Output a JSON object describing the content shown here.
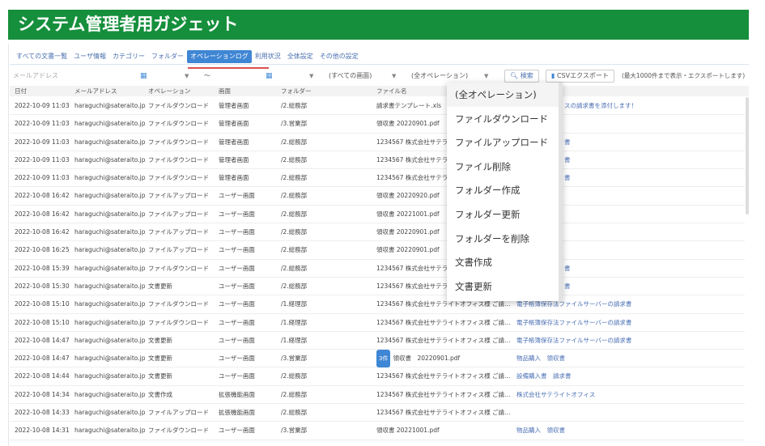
{
  "header": {
    "title": "システム管理者用ガジェット",
    "color": "#168f3c"
  },
  "tabs": [
    {
      "label": "すべての文書一覧"
    },
    {
      "label": "ユーザ情報"
    },
    {
      "label": "カテゴリー"
    },
    {
      "label": "フォルダー"
    },
    {
      "label": "オペレーションログ",
      "active": true
    },
    {
      "label": "利用状況"
    },
    {
      "label": "全体設定"
    },
    {
      "label": "その他の設定"
    }
  ],
  "filters": {
    "email_placeholder": "メールアドレス",
    "calendar_icon": "calendar-icon",
    "range_sep": "〜",
    "screen": "(すべての画面)",
    "operation": "(全オペレーション)",
    "search_label": "検索",
    "csv_label": "CSVエクスポート",
    "note": "(最大1000件まで表示・エクスポートします)"
  },
  "columns": [
    "日付",
    "メールアドレス",
    "オペレーション",
    "画面",
    "フォルダー",
    "ファイル名"
  ],
  "rows": [
    [
      "2022-10-09 11:03",
      "haraguchi@sateraito.jp",
      "ファイルダウンロード",
      "管理者画面",
      "/2.総務部",
      "請求書テンプレート.xls",
      "スの請求書を添付します！"
    ],
    [
      "2022-10-09 11:03",
      "haraguchi@sateraito.jp",
      "ファイルダウンロード",
      "管理者画面",
      "/3.営業部",
      "領収書 20220901.pdf",
      ""
    ],
    [
      "2022-10-09 11:03",
      "haraguchi@sateraito.jp",
      "ファイルダウンロード",
      "管理者画面",
      "/2.総務部",
      "1234567 株式会社サテラ",
      "書"
    ],
    [
      "2022-10-09 11:03",
      "haraguchi@sateraito.jp",
      "ファイルダウンロード",
      "管理者画面",
      "/2.総務部",
      "1234567 株式会社サテラ",
      "書"
    ],
    [
      "2022-10-09 11:03",
      "haraguchi@sateraito.jp",
      "ファイルダウンロード",
      "管理者画面",
      "/2.総務部",
      "1234567 株式会社サテラ",
      "書"
    ],
    [
      "2022-10-08 16:42",
      "haraguchi@sateraito.jp",
      "ファイルアップロード",
      "ユーザー画面",
      "/2.総務部",
      "領収書 20220920.pdf",
      ""
    ],
    [
      "2022-10-08 16:42",
      "haraguchi@sateraito.jp",
      "ファイルアップロード",
      "ユーザー画面",
      "/2.総務部",
      "領収書 20221001.pdf",
      ""
    ],
    [
      "2022-10-08 16:42",
      "haraguchi@sateraito.jp",
      "ファイルアップロード",
      "ユーザー画面",
      "/2.総務部",
      "領収書 20220901.pdf",
      ""
    ],
    [
      "2022-10-08 16:25",
      "haraguchi@sateraito.jp",
      "ファイルアップロード",
      "ユーザー画面",
      "/2.総務部",
      "領収書 20220901.pdf",
      ""
    ],
    [
      "2022-10-08 15:39",
      "haraguchi@sateraito.jp",
      "ファイルダウンロード",
      "ユーザー画面",
      "/2.総務部",
      "1234567 株式会社サテラ",
      "書"
    ],
    [
      "2022-10-08 15:30",
      "haraguchi@sateraito.jp",
      "文書更新",
      "ユーザー画面",
      "/2.総務部",
      "1234567 株式会社サテラ",
      "書"
    ],
    [
      "2022-10-08 15:10",
      "haraguchi@sateraito.jp",
      "ファイルダウンロード",
      "ユーザー画面",
      "/1.経理部",
      "1234567 株式会社サテライトオフィス様 ご請…",
      "電子帳簿保存法ファイルサーバーの請求書"
    ],
    [
      "2022-10-08 15:10",
      "haraguchi@sateraito.jp",
      "ファイルダウンロード",
      "ユーザー画面",
      "/1.経理部",
      "1234567 株式会社サテライトオフィス様 ご請…",
      "電子帳簿保存法ファイルサーバーの請求書"
    ],
    [
      "2022-10-08 14:47",
      "haraguchi@sateraito.jp",
      "文書更新",
      "ユーザー画面",
      "/1.経理部",
      "1234567 株式会社サテライトオフィス様 ご請…",
      "電子帳簿保存法ファイルサーバーの請求書"
    ],
    [
      "2022-10-08 14:47",
      "haraguchi@sateraito.jp",
      "文書更新",
      "ユーザー画面",
      "/3.営業部",
      "領収書　20220901.pdf",
      "物品購入　領収書",
      "3件"
    ],
    [
      "2022-10-08 14:44",
      "haraguchi@sateraito.jp",
      "文書更新",
      "ユーザー画面",
      "/2.総務部",
      "1234567 株式会社サテライトオフィス様 ご請…",
      "設備購入書　請求書"
    ],
    [
      "2022-10-08 14:34",
      "haraguchi@sateraito.jp",
      "文書作成",
      "拡張機能画面",
      "/2.総務部",
      "1234567 株式会社サテライトオフィス様 ご請…",
      "株式会社サテライトオフィス"
    ],
    [
      "2022-10-08 14:33",
      "haraguchi@sateraito.jp",
      "ファイルアップロード",
      "拡張機能画面",
      "/2.総務部",
      "1234567 株式会社サテライトオフィス様 ご請…",
      ""
    ],
    [
      "2022-10-08 14:31",
      "haraguchi@sateraito.jp",
      "ファイルダウンロード",
      "ユーザー画面",
      "/3.営業部",
      "領収書 20221001.pdf",
      "物品購入　領収書"
    ]
  ],
  "dropdown": {
    "items": [
      "(全オペレーション)",
      "ファイルダウンロード",
      "ファイルアップロード",
      "ファイル削除",
      "フォルダー作成",
      "フォルダー更新",
      "フォルダーを削除",
      "文書作成",
      "文書更新"
    ],
    "selected": 0
  }
}
